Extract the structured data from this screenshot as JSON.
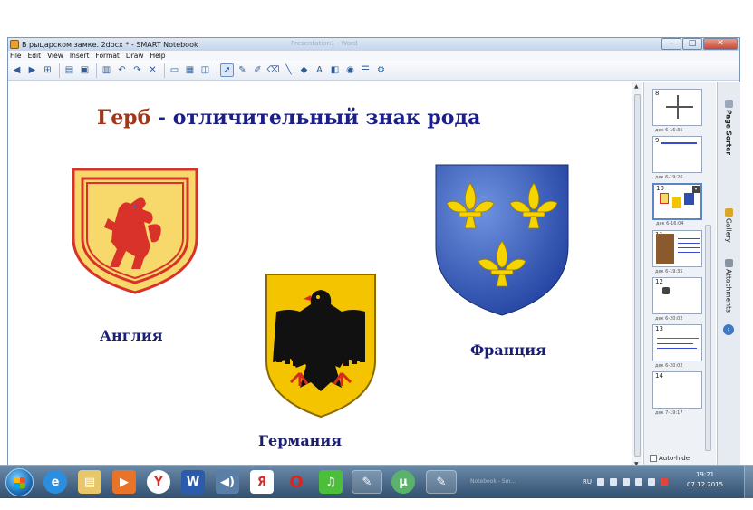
{
  "window": {
    "title": "В рыцарском замке. 2docx * - SMART Notebook",
    "background_title": "Presentation1 - Word"
  },
  "menu": [
    "File",
    "Edit",
    "View",
    "Insert",
    "Format",
    "Draw",
    "Help"
  ],
  "slide": {
    "title_red": "Герб",
    "title_rest": " - отличительный знак рода",
    "captions": {
      "england": "Англия",
      "germany": "Германия",
      "france": "Франция"
    },
    "colors": {
      "title_blue": "#1b1f88",
      "title_red": "#a0371a",
      "england_gold": "#f7d86a",
      "england_red": "#d9322b",
      "france_blue": "#2b4fb5",
      "france_gold": "#f5d400",
      "germany_gold": "#f5c400",
      "germany_black": "#111111",
      "germany_red": "#d42a1f"
    }
  },
  "page_sorter": {
    "pages": [
      {
        "num": "8",
        "stamp": "дек 6-16:35"
      },
      {
        "num": "9",
        "stamp": "дек 6-19:26"
      },
      {
        "num": "10",
        "stamp": "дек 6-16:04",
        "active": true
      },
      {
        "num": "11",
        "stamp": "дек 6-19:35"
      },
      {
        "num": "12",
        "stamp": "дек 6-20:02"
      },
      {
        "num": "13",
        "stamp": "дек 6-20:02"
      },
      {
        "num": "14",
        "stamp": "дек 7-19:17"
      }
    ],
    "autohide_label": "Auto-hide"
  },
  "side_tabs": [
    "Page Sorter",
    "Gallery",
    "Attachments"
  ],
  "taskbar": {
    "tray_lang": "RU",
    "time": "19:21",
    "date": "07.12.2015",
    "dim_text": "Notebook - Sm..."
  }
}
